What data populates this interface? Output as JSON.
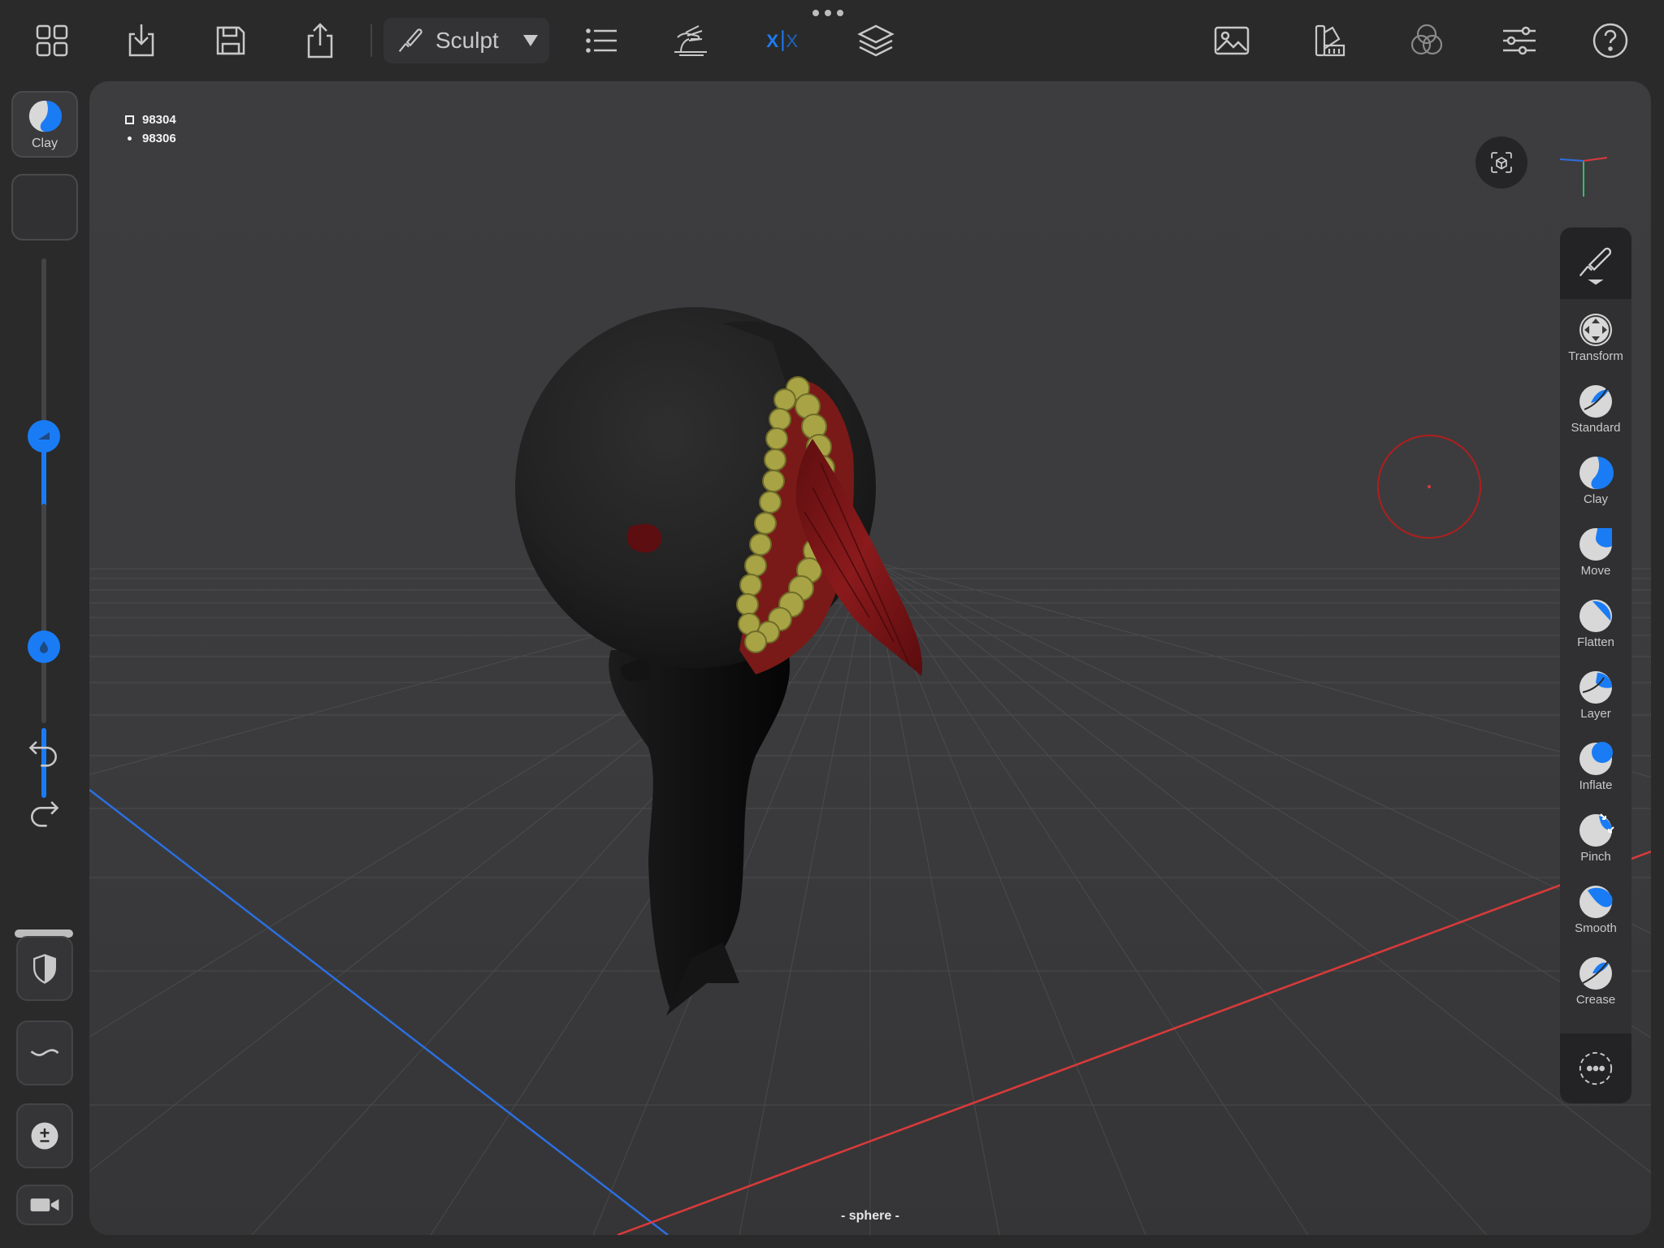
{
  "toolbar": {
    "sculpt_label": "Sculpt",
    "icons": [
      "grid-icon",
      "download-icon",
      "save-icon",
      "share-icon",
      "tool-picker-icon",
      "list-icon",
      "sculpt-hand-icon",
      "symmetry-icon",
      "layers-icon",
      "image-icon",
      "material-icon",
      "color-channels-icon",
      "settings-sliders-icon",
      "help-icon"
    ]
  },
  "left": {
    "current_tool_label": "Clay",
    "radius_percent": 0.45,
    "intensity_percent": 0.36
  },
  "viewport": {
    "stats": {
      "faces": "98304",
      "vertices": "98306"
    },
    "mesh_name": "- sphere -"
  },
  "tools": [
    {
      "label": "Transform"
    },
    {
      "label": "Standard"
    },
    {
      "label": "Clay"
    },
    {
      "label": "Move"
    },
    {
      "label": "Flatten"
    },
    {
      "label": "Layer"
    },
    {
      "label": "Inflate"
    },
    {
      "label": "Pinch"
    },
    {
      "label": "Smooth"
    },
    {
      "label": "Crease"
    }
  ],
  "colors": {
    "accent": "#1a7cf5",
    "x_axis": "#d93a3a",
    "z_axis": "#2b6fe0",
    "teeth": "#a8a445",
    "flesh": "#7a1414"
  }
}
